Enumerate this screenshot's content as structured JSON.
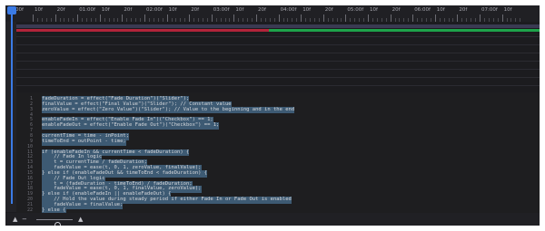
{
  "timeline": {
    "labels": [
      "10f",
      "20f",
      "01:00f",
      "10f",
      "20f",
      "02:00f",
      "10f",
      "20f",
      "03:00f",
      "10f",
      "20f",
      "04:00f",
      "10f",
      "20f",
      "05:00f",
      "10f",
      "20f",
      "06:00f",
      "10f",
      "20f",
      "07:00f",
      "10f"
    ],
    "playhead_label": "00f",
    "colors": {
      "playhead": "#3b7be6",
      "layer_before": "#b3243a",
      "layer_after": "#1ea34a",
      "selection": "#3d5a73"
    }
  },
  "code": {
    "lines": [
      {
        "n": "1",
        "text": "fadeDuration = effect(\"Fade Duration\")(\"Slider\");",
        "selected": true
      },
      {
        "n": "2",
        "text": "finalValue = effect(\"Final Value\")(\"Slider\"); // Constant value",
        "selected": true
      },
      {
        "n": "3",
        "text": "zeroValue = effect(\"Zero Value\")(\"Slider\"); // Value to the beginning and in the end",
        "selected": true
      },
      {
        "n": "4",
        "text": "",
        "selected": false
      },
      {
        "n": "5",
        "text": "enableFadeIn = effect(\"Enable Fade In\")(\"Checkbox\") == 1;",
        "selected": true
      },
      {
        "n": "6",
        "text": "enableFadeOut = effect(\"Enable Fade Out\")(\"Checkbox\") == 1;",
        "selected": true
      },
      {
        "n": "7",
        "text": "",
        "selected": false
      },
      {
        "n": "8",
        "text": "currentTime = time - inPoint;",
        "selected": true
      },
      {
        "n": "9",
        "text": "timeToEnd = outPoint - time;",
        "selected": true
      },
      {
        "n": "10",
        "text": "",
        "selected": false
      },
      {
        "n": "11",
        "text": "if (enableFadeIn && currentTime < fadeDuration) {",
        "selected": true
      },
      {
        "n": "12",
        "text": "    // Fade In logic",
        "selected": true
      },
      {
        "n": "13",
        "text": "    t = currentTime / fadeDuration;",
        "selected": true
      },
      {
        "n": "14",
        "text": "    fadeValue = ease(t, 0, 1, zeroValue, finalValue);",
        "selected": true
      },
      {
        "n": "15",
        "text": "} else if (enableFadeOut && timeToEnd < fadeDuration) {",
        "selected": true
      },
      {
        "n": "16",
        "text": "    // Fade Out logic",
        "selected": true
      },
      {
        "n": "17",
        "text": "    t = (fadeDuration - timeToEnd) / fadeDuration;",
        "selected": true
      },
      {
        "n": "18",
        "text": "    fadeValue = ease(t, 0, 1, finalValue, zeroValue);",
        "selected": true
      },
      {
        "n": "19",
        "text": "} else if (enableFadeIn || enableFadeOut) {",
        "selected": true
      },
      {
        "n": "20",
        "text": "    // Hold the value during steady period if either Fade In or Fade Out is enabled",
        "selected": true
      },
      {
        "n": "21",
        "text": "    fadeValue = finalValue;",
        "selected": true
      },
      {
        "n": "22",
        "text": "} else {",
        "selected": true
      }
    ]
  },
  "bottom_bar": {
    "icons": [
      "triangle-icon",
      "zoom-out-icon",
      "zoom-in-icon"
    ]
  }
}
